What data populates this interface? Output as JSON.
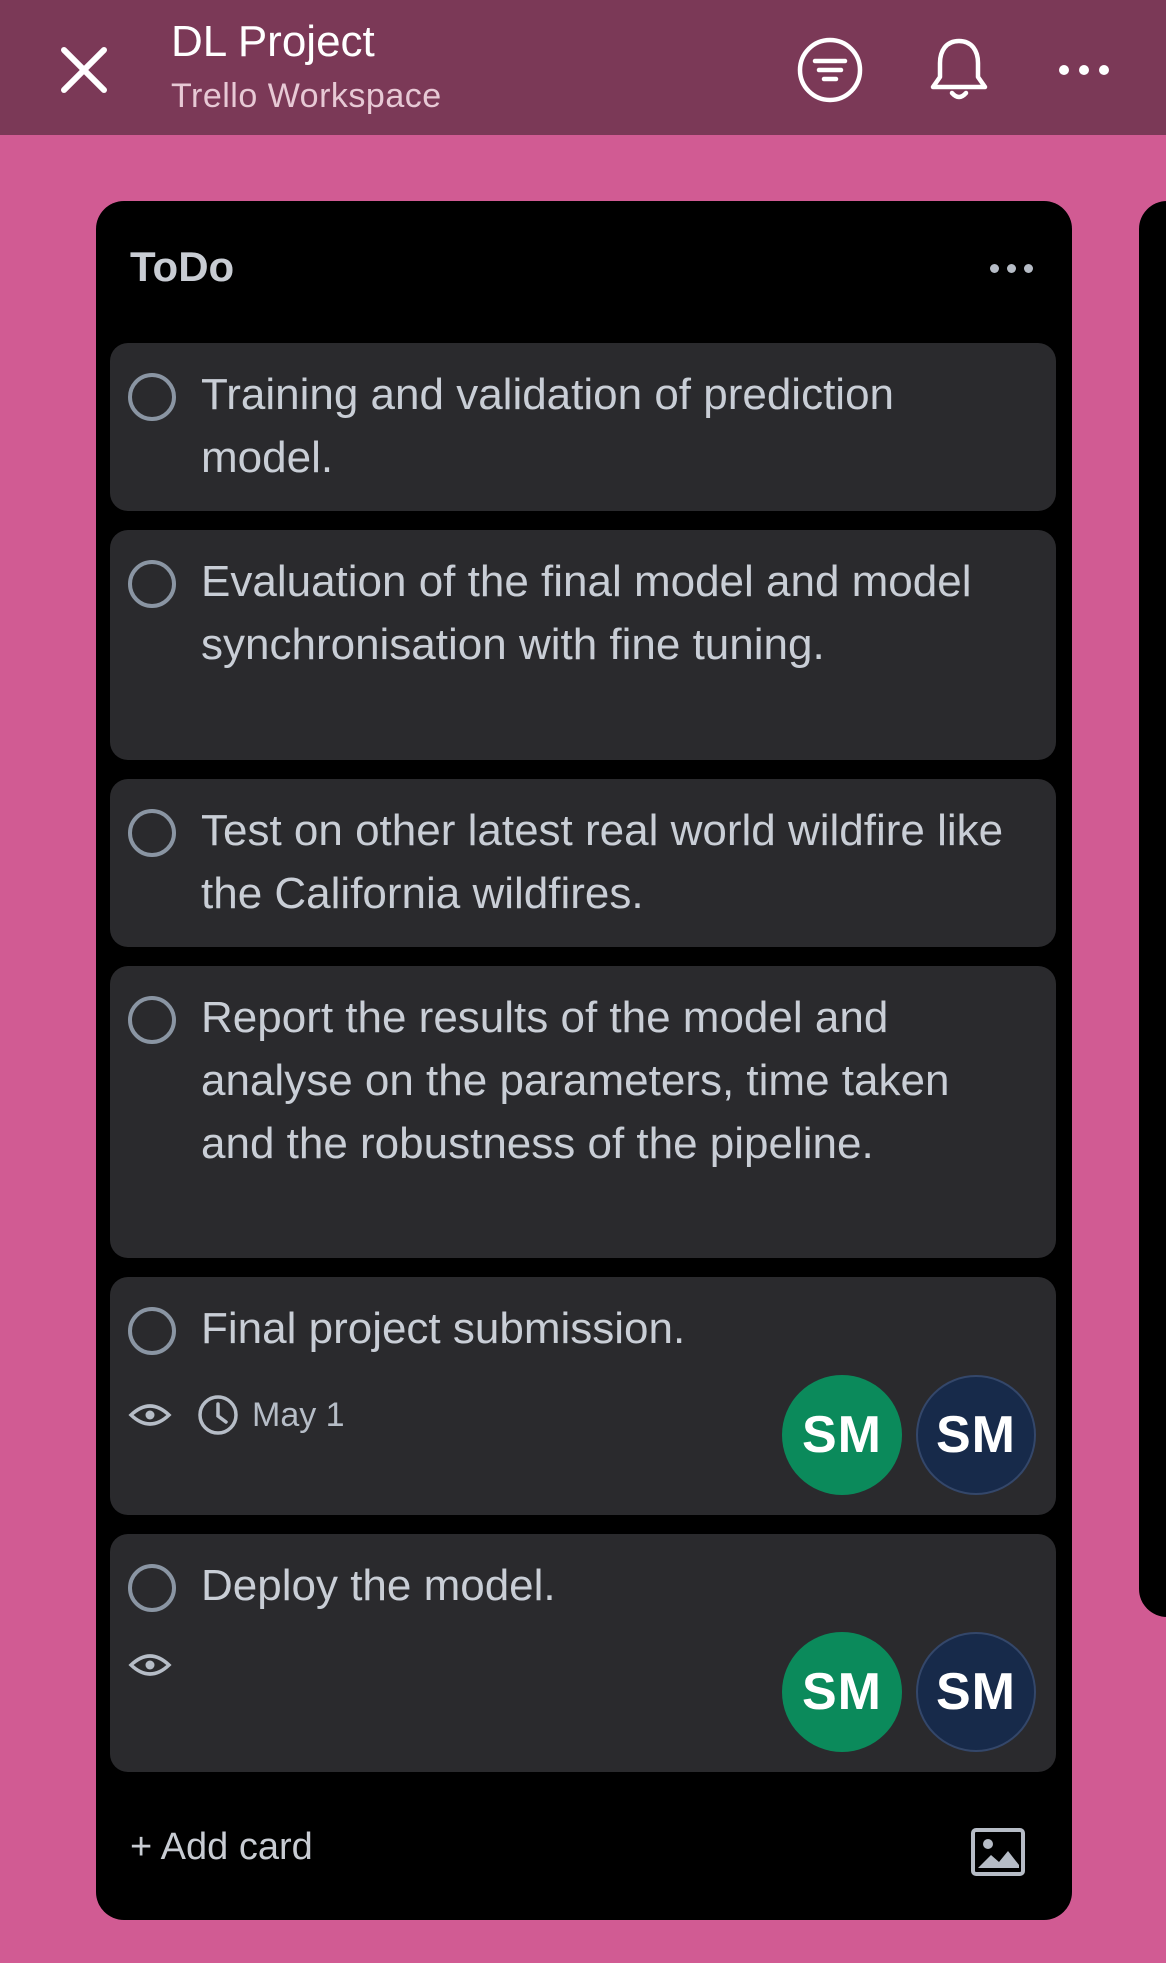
{
  "header": {
    "title": "DL Project",
    "subtitle": "Trello Workspace",
    "icons": [
      "close-icon",
      "filter-icon",
      "bell-icon",
      "more-icon"
    ]
  },
  "list": {
    "title": "ToDo",
    "add_card_label": "+ Add card",
    "cards": [
      {
        "text": "Training and validation of prediction model."
      },
      {
        "text": "Evaluation of the final model and model synchronisation with fine tuning."
      },
      {
        "text": "Test on other latest real world wildfire like the California wildfires."
      },
      {
        "text": "Report the results of the model and analyse on the parameters, time taken and the robustness of the pipeline."
      },
      {
        "text": "Final project submission.",
        "due": "May 1",
        "members": [
          "SM",
          "SM"
        ]
      },
      {
        "text": "Deploy the model.",
        "members": [
          "SM",
          "SM"
        ]
      }
    ]
  },
  "colors": {
    "background": "#d15b93",
    "header": "#7b3957",
    "list": "#000000",
    "card": "#2a2a2d",
    "avatar_green": "#0b8a5b",
    "avatar_navy": "#172a4a"
  }
}
